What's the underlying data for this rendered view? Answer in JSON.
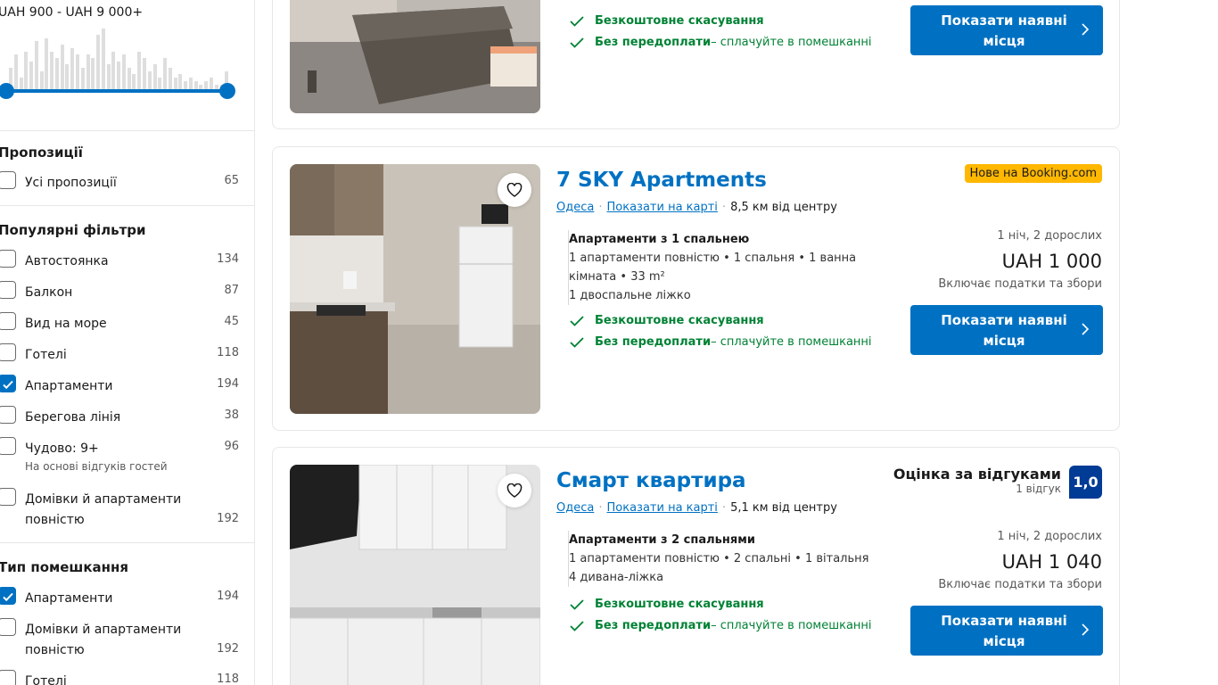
{
  "sidebar": {
    "price_range": "UAH 900 - UAH 9 000+",
    "histogram_levels": [
      0.35,
      0.55,
      0.2,
      0.6,
      0.45,
      0.75,
      0.3,
      0.8,
      0.6,
      0.5,
      0.7,
      0.4,
      0.65,
      0.55,
      0.35,
      0.55,
      0.5,
      0.85,
      0.95,
      0.4,
      0.6,
      0.45,
      0.55,
      0.35,
      0.25,
      0.6,
      0.5,
      0.3,
      0.4,
      0.2,
      0.5,
      0.35,
      0.2,
      0.25,
      0.15,
      0.2,
      0.15,
      0.1,
      0.15,
      0.2,
      0.1,
      0.1,
      0.3
    ],
    "offers": {
      "title": "Пропозиції",
      "items": [
        {
          "label": "Усі пропозиції",
          "count": "65",
          "checked": false
        }
      ]
    },
    "popular": {
      "title": "Популярні фільтри",
      "items": [
        {
          "label": "Автостоянка",
          "count": "134",
          "checked": false
        },
        {
          "label": "Балкон",
          "count": "87",
          "checked": false
        },
        {
          "label": "Вид на море",
          "count": "45",
          "checked": false
        },
        {
          "label": "Готелі",
          "count": "118",
          "checked": false
        },
        {
          "label": "Апартаменти",
          "count": "194",
          "checked": true
        },
        {
          "label": "Берегова лінія",
          "count": "38",
          "checked": false
        },
        {
          "label": "Чудово: 9+",
          "count": "96",
          "checked": false,
          "sub": "На основі відгуків гостей"
        },
        {
          "label": "Домівки й апартаменти повністю",
          "count": "192",
          "checked": false
        }
      ]
    },
    "property_type": {
      "title": "Тип помешкання",
      "items": [
        {
          "label": "Апартаменти",
          "count": "194",
          "checked": true
        },
        {
          "label": "Домівки й апартаменти повністю",
          "count": "192",
          "checked": false
        },
        {
          "label": "Готелі",
          "count": "118",
          "checked": false
        }
      ]
    }
  },
  "cards": [
    {
      "perks": {
        "free_cancel": "Безкоштовне скасування",
        "no_prepay_bold": "Без передоплати",
        "no_prepay_rest": " – сплачуйте в помешканні"
      },
      "cta": "Показати наявні місця"
    },
    {
      "title": "7 SKY Apartments",
      "badge": "Нове на Booking.com",
      "city": "Одеса",
      "map_link": "Показати на карті",
      "distance": "8,5 км від центру",
      "unit_title": "Апартаменти з 1 спальнею",
      "unit_desc": "1 апартаменти повністю • 1 спальня • 1 ванна кімната • 33 m²",
      "beds": "1 двоспальне ліжко",
      "perks": {
        "free_cancel": "Безкоштовне скасування",
        "no_prepay_bold": "Без передоплати",
        "no_prepay_rest": " – сплачуйте в помешканні"
      },
      "guests": "1 ніч, 2 дорослих",
      "price": "UAH 1 000",
      "taxes": "Включає податки та збори",
      "cta": "Показати наявні місця"
    },
    {
      "title": "Смарт квартира",
      "review_label": "Оцінка за відгуками",
      "review_count": "1 відгук",
      "review_score": "1,0",
      "city": "Одеса",
      "map_link": "Показати на карті",
      "distance": "5,1 км від центру",
      "unit_title": "Апартаменти з 2 спальнями",
      "unit_desc": "1 апартаменти повністю • 2 спальні • 1 вітальня",
      "beds": "4 дивана-ліжка",
      "perks": {
        "free_cancel": "Безкоштовне скасування",
        "no_prepay_bold": "Без передоплати",
        "no_prepay_rest": " – сплачуйте в помешканні"
      },
      "guests": "1 ніч, 2 дорослих",
      "price": "UAH 1 040",
      "taxes": "Включає податки та збори",
      "cta": "Показати наявні місця"
    }
  ],
  "colors": {
    "accent": "#0071c2",
    "green": "#008234",
    "badge": "#ffb700",
    "score": "#003b95"
  },
  "icons": {
    "heart": "heart-icon",
    "check": "checkmark-icon",
    "chevron": "chevron-right-icon"
  }
}
